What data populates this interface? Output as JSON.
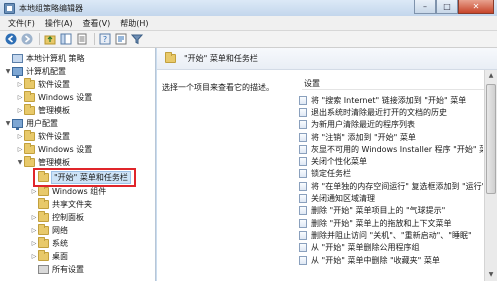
{
  "window": {
    "title": "本地组策略编辑器"
  },
  "menu": [
    "文件(F)",
    "操作(A)",
    "查看(V)",
    "帮助(H)"
  ],
  "toolbar": {
    "icons": [
      "back-icon",
      "forward-icon",
      "up-folder-icon",
      "show-hide-tree-icon",
      "export-list-icon",
      "help-icon",
      "properties-icon",
      "filter-icon"
    ]
  },
  "tree": [
    {
      "label": "本地计算机 策略",
      "icon": "policy",
      "arrow": ""
    },
    {
      "label": "计算机配置",
      "icon": "pc",
      "arrow": "▼"
    },
    {
      "label": "软件设置",
      "icon": "folder",
      "arrow": "▷"
    },
    {
      "label": "Windows 设置",
      "icon": "folder",
      "arrow": "▷"
    },
    {
      "label": "管理模板",
      "icon": "folder",
      "arrow": "▷"
    },
    {
      "label": "用户配置",
      "icon": "pc",
      "arrow": "▼"
    },
    {
      "label": "软件设置",
      "icon": "folder",
      "arrow": "▷"
    },
    {
      "label": "Windows 设置",
      "icon": "folder",
      "arrow": "▷"
    },
    {
      "label": "管理模板",
      "icon": "folder",
      "arrow": "▼"
    },
    {
      "label": "\"开始\" 菜单和任务栏",
      "icon": "folder",
      "arrow": "",
      "selected": true
    },
    {
      "label": "Windows 组件",
      "icon": "folder",
      "arrow": "▷"
    },
    {
      "label": "共享文件夹",
      "icon": "folder",
      "arrow": ""
    },
    {
      "label": "控制面板",
      "icon": "folder",
      "arrow": "▷"
    },
    {
      "label": "网络",
      "icon": "folder",
      "arrow": "▷"
    },
    {
      "label": "系统",
      "icon": "folder",
      "arrow": "▷"
    },
    {
      "label": "桌面",
      "icon": "folder",
      "arrow": "▷"
    },
    {
      "label": "所有设置",
      "icon": "settings",
      "arrow": ""
    }
  ],
  "right": {
    "header": "\"开始\" 菜单和任务栏",
    "description": "选择一个项目来查看它的描述。",
    "column": "设置",
    "settings": [
      "将 \"搜索 Internet\" 链接添加到 \"开始\" 菜单",
      "退出系统时清除最近打开的文档的历史",
      "为新用户清除最近的程序列表",
      "将 \"注销\" 添加到 \"开始\" 菜单",
      "灰显不可用的 Windows Installer 程序 \"开始\" 菜单",
      "关闭个性化菜单",
      "锁定任务栏",
      "将 \"在单独的内存空间运行\" 复选框添加到 \"运行\"",
      "关闭通知区域清理",
      "删除 \"开始\" 菜单项目上的 \"气球提示\"",
      "删除 \"开始\" 菜单上的拖放和上下文菜单",
      "删除并阻止访问 \"关机\"、\"重新启动\"、\"睡眠\"",
      "从 \"开始\" 菜单删除公用程序组",
      "从 \"开始\" 菜单中删除 \"收藏夹\" 菜单"
    ]
  }
}
